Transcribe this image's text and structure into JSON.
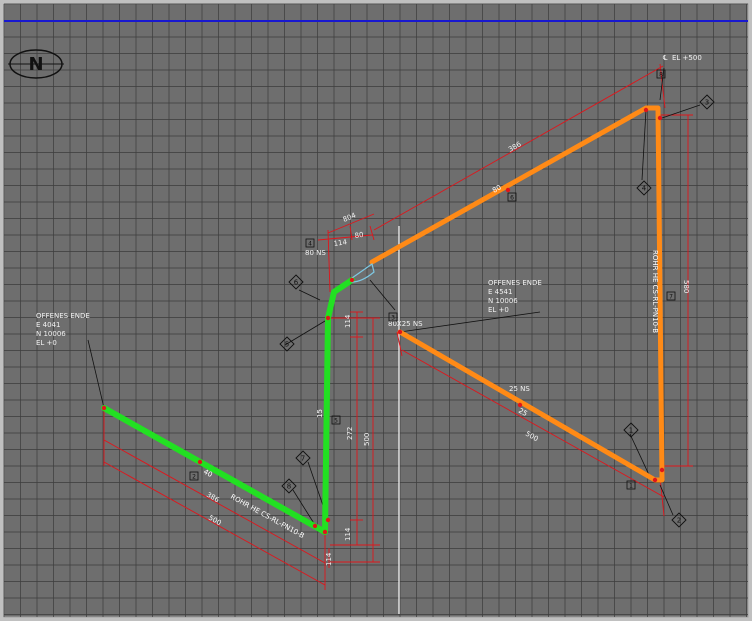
{
  "colors": {
    "background": "#6e6e6e",
    "grid": "#3c3c3c",
    "pipe_green": "#22e022",
    "pipe_orange": "#ff8a16",
    "dimension": "#e0151b",
    "leader": "#111111",
    "header_line": "#1818d0",
    "fitting_outline": "#7ec8e3"
  },
  "north_label": "N",
  "annotations": {
    "open_end_left": {
      "title": "OFFENES ENDE",
      "e": "E 4041",
      "n": "N 10006",
      "el": "EL +0"
    },
    "open_end_right": {
      "title": "OFFENES ENDE",
      "e": "E 4541",
      "n": "N 10006",
      "el": "EL +0"
    },
    "top_elevation": "EL +500",
    "size_80ns": "80 NS",
    "size_80_25ns": "80X25 NS",
    "size_25ns": "25 NS"
  },
  "dimensions": {
    "d386_top": "386",
    "d804": "804",
    "d114_top": "114",
    "d80": "80",
    "d114_a": "114",
    "d272": "272",
    "d500_vert": "500",
    "d114_b": "114",
    "d114_bottom": "114",
    "d386_bottom": "386",
    "d500_left": "500",
    "d500_right": "500",
    "d580": "580"
  },
  "tags": [
    "1",
    "2",
    "3",
    "4",
    "5",
    "6",
    "7",
    "8"
  ],
  "square_tags": [
    "1",
    "2",
    "3",
    "4",
    "5",
    "6",
    "7",
    "8"
  ],
  "pipe_texts": {
    "green_spec": "ROHR HE CS-RL-PN10-B",
    "orange_spec": "ROHR HE CS-RL-PN10-B",
    "v40": "40",
    "v80": "80",
    "v15": "15",
    "v25": "25"
  }
}
